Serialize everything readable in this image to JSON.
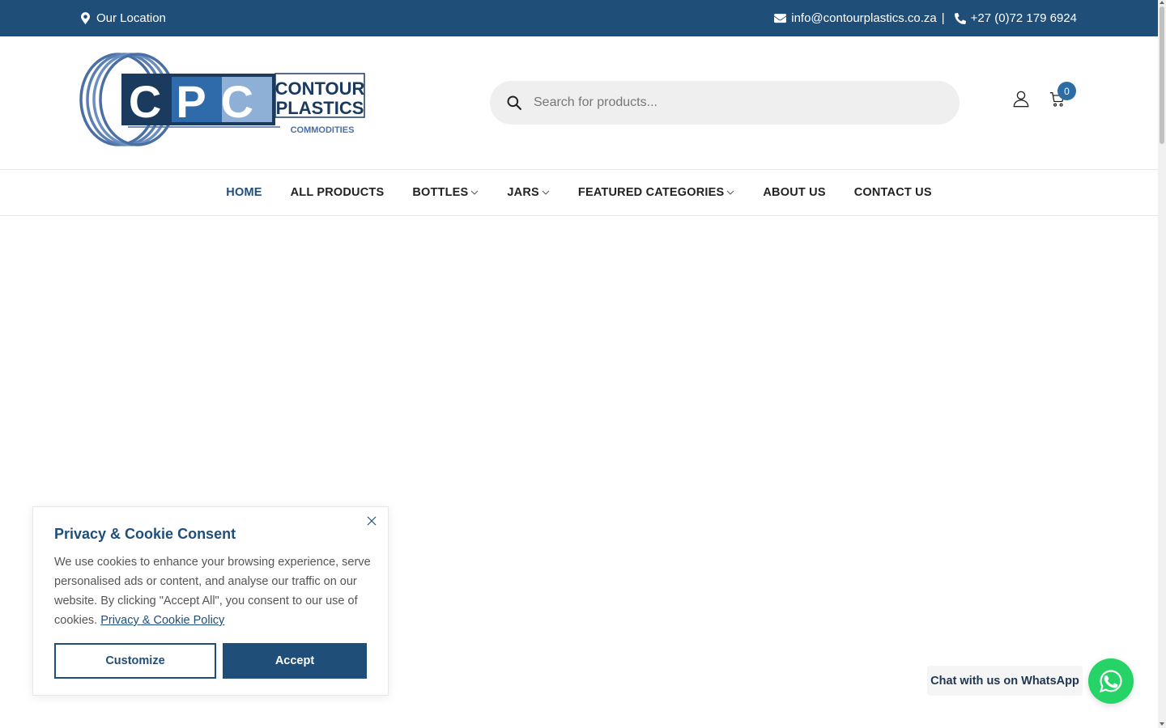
{
  "topbar": {
    "location_label": "Our Location",
    "email": "info@contourplastics.co.za",
    "separator": "|",
    "phone": "+27 (0)72 179 6924"
  },
  "header": {
    "logo": {
      "initials": "CPC",
      "line1": "CONTOUR",
      "line2": "PLASTICS",
      "line3": "COMMODITIES"
    },
    "search": {
      "placeholder": "Search for products..."
    },
    "cart_count": "0"
  },
  "nav": {
    "items": [
      {
        "label": "HOME",
        "active": true
      },
      {
        "label": "ALL PRODUCTS"
      },
      {
        "label": "BOTTLES",
        "dropdown": true
      },
      {
        "label": "JARS",
        "dropdown": true
      },
      {
        "label": "FEATURED CATEGORIES",
        "dropdown": true
      },
      {
        "label": "ABOUT US"
      },
      {
        "label": "CONTACT US"
      }
    ]
  },
  "cookie": {
    "title": "Privacy & Cookie Consent",
    "body": "We use cookies to enhance your browsing experience, serve personalised ads or content, and analyse our traffic on our website. By clicking \"Accept All\", you consent to our use of cookies.",
    "policy_link": "Privacy & Cookie Policy",
    "customize_label": "Customize",
    "accept_label": "Accept"
  },
  "whatsapp": {
    "label": "Chat with us on WhatsApp"
  },
  "colors": {
    "brand": "#1f4e79",
    "accent": "#2e6da4",
    "whatsapp": "#25d366"
  }
}
